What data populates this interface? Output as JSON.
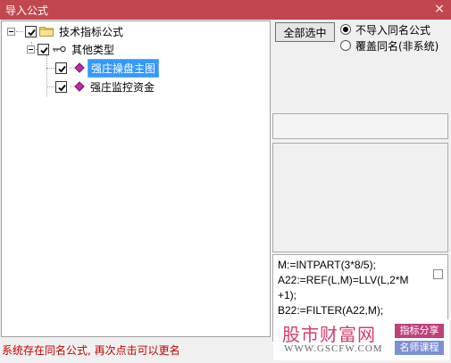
{
  "window": {
    "title": "导入公式",
    "close_symbol": "×"
  },
  "tree": {
    "root": {
      "label": "技术指标公式",
      "checked": true,
      "expanded": true
    },
    "group": {
      "label": "其他类型",
      "checked": true,
      "expanded": true
    },
    "items": [
      {
        "label": "强庄操盘主图",
        "checked": true,
        "selected": true
      },
      {
        "label": "强庄监控资金",
        "checked": true,
        "selected": false
      }
    ]
  },
  "options": {
    "select_all_label": "全部选中",
    "radio_skip_label": "不导入同名公式",
    "radio_overwrite_label": "覆盖同名(非系统)",
    "selected_radio": "skip"
  },
  "formula": {
    "lines": [
      "M:=INTPART(3*8/5);",
      "A22:=REF(L,M)=LLV(L,2*M",
      "+1);",
      "B22:=FILTER(A22,M);"
    ]
  },
  "status": {
    "message": "系统存在同名公式, 再次点击可以更名"
  },
  "watermark": {
    "name": "股市财富网",
    "url": "WWW.GSCFW.COM",
    "tag1": "指标分享",
    "tag2": "名师课程"
  },
  "colors": {
    "titlebar": "#c0474f",
    "selection": "#3399ff",
    "status_text": "#c00000"
  }
}
